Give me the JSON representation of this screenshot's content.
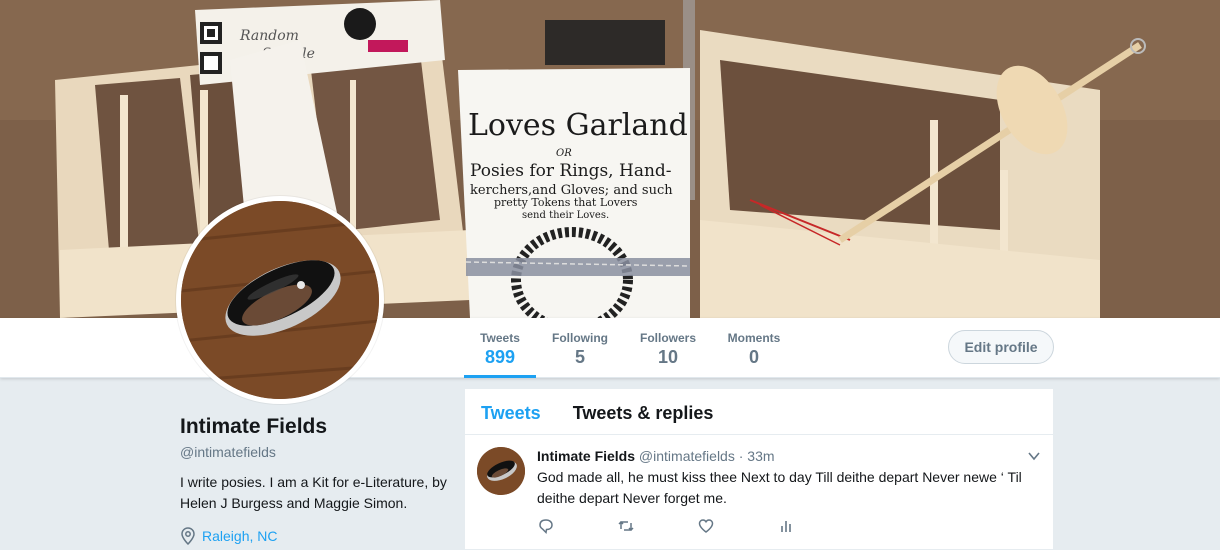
{
  "banner": {
    "book_title": "Loves Garland",
    "book_or": "OR",
    "book_line1": "Posies for Rings, Hand-",
    "book_line2": "kerchers,and Gloves; and such",
    "book_line3": "pretty Tokens that Lovers",
    "book_line4": "send their Loves.",
    "card_text_1": "Random",
    "card_text_2": "Sample"
  },
  "stats": {
    "tweets": {
      "label": "Tweets",
      "value": "899"
    },
    "following": {
      "label": "Following",
      "value": "5"
    },
    "followers": {
      "label": "Followers",
      "value": "10"
    },
    "moments": {
      "label": "Moments",
      "value": "0"
    }
  },
  "edit_profile_label": "Edit profile",
  "profile": {
    "name": "Intimate Fields",
    "handle": "@intimatefields",
    "bio": "I write posies. I am a Kit for e-Literature, by Helen J Burgess and Maggie Simon.",
    "location": "Raleigh, NC"
  },
  "timeline": {
    "tabs": [
      "Tweets",
      "Tweets & replies"
    ],
    "tweet": {
      "author": "Intimate Fields",
      "handle": "@intimatefields",
      "separator": "·",
      "time": "33m",
      "text": "God made all, he must kiss thee Next to day Till deithe depart Never newe ‘ Til deithe depart Never forget me."
    }
  },
  "icons": {
    "location": "location-pin-icon",
    "reply": "reply-icon",
    "retweet": "retweet-icon",
    "like": "heart-icon",
    "analytics": "analytics-icon",
    "more": "chevron-down-icon"
  },
  "colors": {
    "accent": "#1da1f2",
    "muted": "#657786",
    "background": "#e6ecf0"
  }
}
